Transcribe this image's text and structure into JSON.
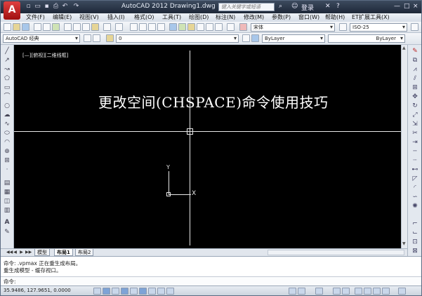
{
  "app": {
    "logo_letter": "A",
    "title": "AutoCAD 2012   Drawing1.dwg",
    "search_placeholder": "键入关键字或短语",
    "login": "登录",
    "window_controls": [
      "—",
      "□",
      "×"
    ],
    "quick_access_icons": [
      "new-icon",
      "open-icon",
      "save-icon",
      "print-icon",
      "undo-icon",
      "redo-icon"
    ]
  },
  "menu": {
    "items": [
      "文件(F)",
      "编辑(E)",
      "视图(V)",
      "插入(I)",
      "格式(O)",
      "工具(T)",
      "绘图(D)",
      "标注(N)",
      "修改(M)",
      "参数(P)",
      "窗口(W)",
      "帮助(H)",
      "ET扩展工具(X)"
    ]
  },
  "toolbar_standard": {
    "font_combo": "宋体",
    "dimstyle_combo": "ISO-25"
  },
  "toolbar_layers": {
    "workspace_combo": "AutoCAD 经典",
    "layer_combo": "0",
    "linetype_combo": "ByLayer",
    "lineweight_combo": "ByLayer"
  },
  "canvas": {
    "viewport_label": "[—][俯视][二维线框]",
    "caption": "更改空间(CHSPACE)命令使用技巧",
    "ucs_y": "Y",
    "ucs_x": "X",
    "background": "#000000",
    "line_color": "#e8e8e8"
  },
  "layout_tabs": {
    "nav": [
      "◀◀",
      "◀",
      "▶",
      "▶▶"
    ],
    "tabs": [
      "模型",
      "布局1",
      "布局2"
    ],
    "active": "布局1"
  },
  "command": {
    "history": [
      "命令:  .vpmax 正在重生成布局。",
      "重生成模型 - 缓存视口。"
    ],
    "prompt": "命令:"
  },
  "status": {
    "coords": "35.9486, 127.9651, 0.0000"
  }
}
